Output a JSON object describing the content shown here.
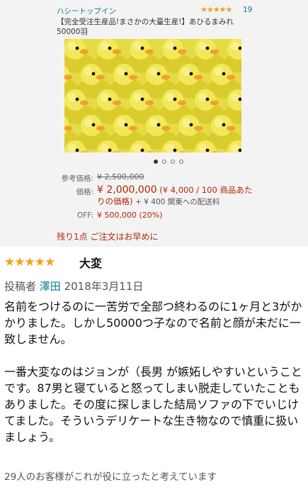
{
  "product": {
    "brand": "ハシートップイン",
    "rating_stars": "★★★★★",
    "rating_count": "19",
    "title": "【完全受注生産品!まさかの大量生産!】あひるまみれ 50000羽",
    "image_alt": "rubber-duck-crowd",
    "carousel": {
      "count": 4,
      "active": 0
    },
    "ref_label": "参考価格:",
    "ref_price": "¥ 2,500,000",
    "price_label": "価格:",
    "price_main": "¥ 2,000,000",
    "price_unit": "(¥ 4,000 / 100 商品あたりの価格)",
    "price_shipping": "+ ¥ 400 関東への配送料",
    "off_label": "OFF:",
    "off_value": "¥ 500,000 (20%)",
    "stock_note": "残り1点 ご注文はお早めに"
  },
  "review": {
    "stars": "★★★★★",
    "title": "大変",
    "author_label": "投稿者",
    "author": "澤田",
    "date": "2018年3月11日",
    "paragraphs": [
      "名前をつけるのに一苦労で全部つ終わるのに1ヶ月と3がかかりました。しかし50000つ子なので名前と顔が未だに一致しません。",
      "一番大変なのはジョンが（長男 が嫉妬しやすいということです。87男と寝ていると怒ってしまい脱走していたこともありました。その度に探しました結局ソファの下でいじけてました。そういうデリケートな生き物なので慎重に扱いましょう。"
    ],
    "helpful": "29人のお客様がこれが役に立ったと考えています"
  }
}
